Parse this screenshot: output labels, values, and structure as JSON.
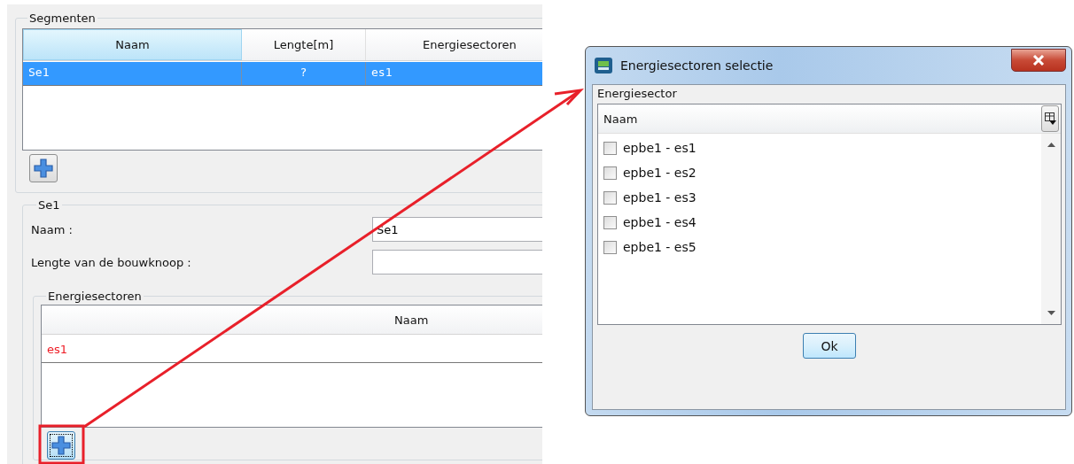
{
  "segments": {
    "title": "Segmenten",
    "columns": [
      {
        "label": "Naam",
        "sorted": true
      },
      {
        "label": "Lengte[m]",
        "sorted": false
      },
      {
        "label": "Energiesectoren",
        "sorted": false
      }
    ],
    "rows": [
      {
        "cells": [
          "Se1",
          "?",
          "es1"
        ],
        "selected": true
      }
    ]
  },
  "segment_detail": {
    "title": "Se1",
    "fields": [
      {
        "label": "Naam :",
        "value": "Se1"
      },
      {
        "label": "Lengte van de bouwknoop :"
      }
    ],
    "energiesectoren": {
      "title": "Energiesectoren",
      "column": "Naam",
      "rows": [
        "es1"
      ]
    }
  },
  "dialog": {
    "title": "Energiesectoren selectie",
    "group": "Energiesector",
    "column": "Naam",
    "items": [
      {
        "label": "epbe1 - es1",
        "checked": false
      },
      {
        "label": "epbe1 - es2",
        "checked": false
      },
      {
        "label": "epbe1 - es3",
        "checked": false
      },
      {
        "label": "epbe1 - es4",
        "checked": false
      },
      {
        "label": "epbe1 - es5",
        "checked": false
      }
    ],
    "button": "Ok"
  }
}
